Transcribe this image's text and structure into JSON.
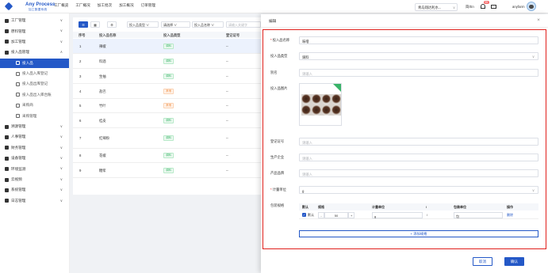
{
  "brand": {
    "title": "Any Process",
    "subtitle": "加工数据系统"
  },
  "topnav": [
    "工厂概览",
    "工厂概况",
    "加工批次",
    "加工概况",
    "订单管理"
  ],
  "header": {
    "org": "青岛翔达利水...",
    "lang": "简/En",
    "bell_count": "99",
    "username": "anyfarm"
  },
  "sidebar": {
    "items": [
      {
        "label": "工厂管理",
        "icon": "factory-icon",
        "chevron": "∨",
        "sub": false
      },
      {
        "label": "原料管理",
        "icon": "material-icon",
        "chevron": "∨",
        "sub": false
      },
      {
        "label": "加工管理",
        "icon": "process-icon",
        "chevron": "∨",
        "sub": false
      },
      {
        "label": "投入品管理",
        "icon": "input-icon",
        "chevron": "∧",
        "sub": false
      },
      {
        "label": "投入品",
        "icon": "circle-icon",
        "chevron": "",
        "sub": true,
        "active": true
      },
      {
        "label": "投入品入库登记",
        "icon": "inbound-icon",
        "chevron": "",
        "sub": true
      },
      {
        "label": "投入品出库登记",
        "icon": "outbound-icon",
        "chevron": "",
        "sub": true
      },
      {
        "label": "投入品出入库台账",
        "icon": "ledger-icon",
        "chevron": "",
        "sub": true
      },
      {
        "label": "采购商",
        "icon": "buyer-icon",
        "chevron": "",
        "sub": true
      },
      {
        "label": "采购管理",
        "icon": "purchase-icon",
        "chevron": "",
        "sub": true
      },
      {
        "label": "溯源管理",
        "icon": "trace-icon",
        "chevron": "∨",
        "sub": false
      },
      {
        "label": "人事管理",
        "icon": "people-icon",
        "chevron": "∨",
        "sub": false
      },
      {
        "label": "财务管理",
        "icon": "finance-icon",
        "chevron": "∨",
        "sub": false
      },
      {
        "label": "设备管理",
        "icon": "device-icon",
        "chevron": "∨",
        "sub": false
      },
      {
        "label": "环境监测",
        "icon": "env-icon",
        "chevron": "∨",
        "sub": false
      },
      {
        "label": "云视频",
        "icon": "video-icon",
        "chevron": "∨",
        "sub": false
      },
      {
        "label": "系统管理",
        "icon": "system-icon",
        "chevron": "∨",
        "sub": false
      },
      {
        "label": "日志管理",
        "icon": "log-icon",
        "chevron": "∨",
        "sub": false
      }
    ]
  },
  "filters": {
    "type": "投入品类型",
    "select": "请选择",
    "name": "投入品名称",
    "name_ph": "请输入关键字"
  },
  "table": {
    "headers": [
      "序号",
      "投入品名称",
      "投入品类型",
      "登记证号"
    ],
    "rows": [
      {
        "no": "1",
        "name": "辣椒",
        "type": "调料",
        "tag": "g",
        "reg": "--"
      },
      {
        "no": "2",
        "name": "料酒",
        "type": "调料",
        "tag": "g",
        "reg": "--"
      },
      {
        "no": "3",
        "name": "生抽",
        "type": "调料",
        "tag": "g",
        "reg": "--"
      },
      {
        "no": "4",
        "name": "盐巴",
        "type": "其他",
        "tag": "o",
        "reg": "--"
      },
      {
        "no": "5",
        "name": "竹叶",
        "type": "其他",
        "tag": "o",
        "reg": "--"
      },
      {
        "no": "6",
        "name": "桂皮",
        "type": "调料",
        "tag": "g",
        "reg": "--"
      },
      {
        "no": "7",
        "name": "红辣粉",
        "type": "调料",
        "tag": "g",
        "reg": "--"
      },
      {
        "no": "8",
        "name": "花椒",
        "type": "调料",
        "tag": "g",
        "reg": "--"
      },
      {
        "no": "9",
        "name": "糖浆",
        "type": "调料",
        "tag": "g",
        "reg": "--"
      }
    ]
  },
  "drawer": {
    "title": "编辑",
    "close": "×",
    "fields": {
      "name_label": "投入品名称",
      "name_value": "味噌",
      "type_label": "投入品类型",
      "type_value": "调料",
      "alias_label": "别名",
      "alias_ph": "请输入",
      "image_label": "投入品图片",
      "reg_label": "登记证号",
      "reg_ph": "请输入",
      "maker_label": "生产企业",
      "maker_ph": "请输入",
      "brand_label": "产品品牌",
      "brand_ph": "请输入",
      "unit_label": "计量单位",
      "unit_value": "g",
      "spec_label": "包装规格"
    },
    "spec_table": {
      "headers": [
        "默认",
        "规格",
        "计量单位",
        "/",
        "包装单位",
        "操作"
      ],
      "row": {
        "default": "默认",
        "minus": "-",
        "qty": "50",
        "plus": "+",
        "unit": "g",
        "slash": "/",
        "pack": "包",
        "action": "删除"
      }
    },
    "add_spec": "+ 添加规格",
    "cancel": "取消",
    "ok": "确认"
  },
  "colors": {
    "primary": "#2458c7",
    "highlight": "#e0201c",
    "tag_green": "#39b368",
    "tag_orange": "#f0893a"
  }
}
